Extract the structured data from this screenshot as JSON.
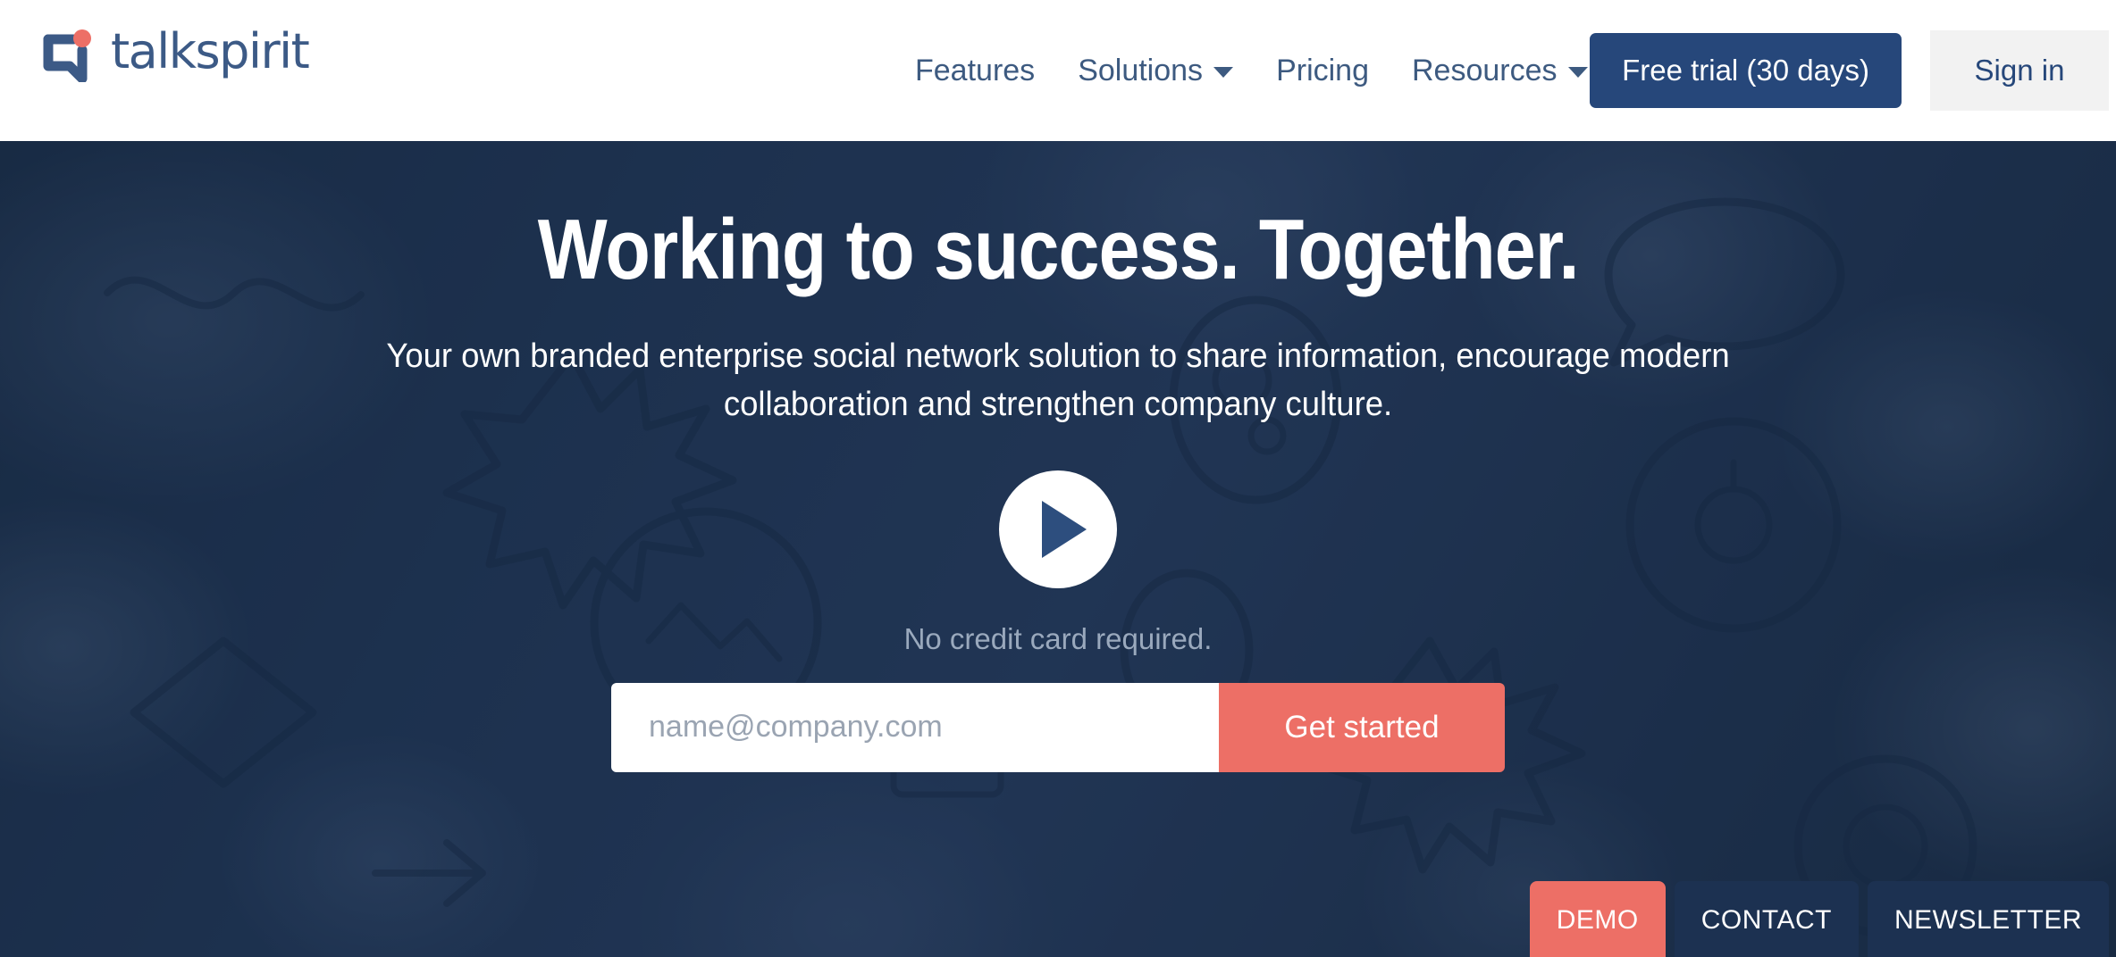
{
  "brand": {
    "name": "talkspirit",
    "logo_icon": "speech-bubble-icon",
    "navy": "#26477a",
    "coral": "#ed6f66",
    "hero_bg": "#1e3350"
  },
  "header": {
    "nav": [
      {
        "label": "Features",
        "has_dropdown": false
      },
      {
        "label": "Solutions",
        "has_dropdown": true
      },
      {
        "label": "Pricing",
        "has_dropdown": false
      },
      {
        "label": "Resources",
        "has_dropdown": true
      }
    ],
    "free_trial_label": "Free trial (30 days)",
    "sign_in_label": "Sign in"
  },
  "hero": {
    "title": "Working to success. Together.",
    "subtitle": "Your own branded enterprise social network solution to share information, encourage modern collaboration and strengthen company culture.",
    "play_icon": "play-icon",
    "no_credit_card": "No credit card required.",
    "email_placeholder": "name@company.com",
    "email_value": "",
    "get_started_label": "Get started"
  },
  "bottom_tabs": [
    {
      "label": "DEMO",
      "active": true
    },
    {
      "label": "CONTACT",
      "active": false
    },
    {
      "label": "NEWSLETTER",
      "active": false
    }
  ]
}
